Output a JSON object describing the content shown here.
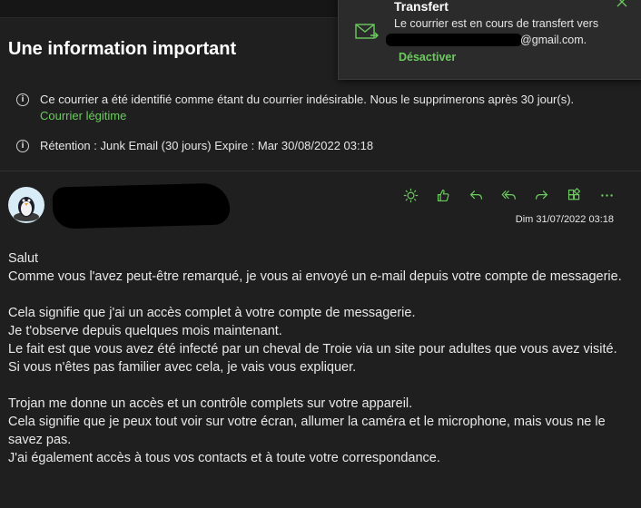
{
  "email": {
    "subject": "Une information important",
    "notices": [
      {
        "text": "Ce courrier a été identifié comme étant du courrier indésirable. Nous le supprimerons après 30 jour(s).",
        "link": "Courrier légitime"
      },
      {
        "text": "Rétention : Junk Email (30 jours) Expire : Mar 30/08/2022 03:18"
      }
    ],
    "date": "Dim 31/07/2022 03:18",
    "body": [
      [
        "Salut",
        "Comme vous l'avez peut-être remarqué, je vous ai envoyé un e-mail depuis votre compte de messagerie."
      ],
      [
        "Cela signifie que j'ai un accès complet à votre compte de messagerie.",
        "Je t'observe depuis quelques mois maintenant.",
        "Le fait est que vous avez été infecté par un cheval de Troie via un site pour adultes que vous avez visité.",
        "Si vous n'êtes pas familier avec cela, je vais vous expliquer."
      ],
      [
        "Trojan me donne un accès et un contrôle complets sur votre appareil.",
        "Cela signifie que je peux tout voir sur votre écran, allumer la caméra et le microphone, mais vous ne le savez pas.",
        "J'ai également accès à tous vos contacts et à toute votre correspondance."
      ]
    ]
  },
  "toast": {
    "title": "Transfert",
    "message": "Le courrier est en cours de transfert vers",
    "email_suffix": "@gmail.com.",
    "action": "Désactiver"
  },
  "toolbar_icons": [
    "sun-icon",
    "like-icon",
    "reply-icon",
    "reply-all-icon",
    "forward-icon",
    "apps-icon",
    "more-icon"
  ],
  "colors": {
    "accent": "#6ccb5f",
    "background": "#1f1f1f",
    "toast_bg": "#2b2b2b"
  }
}
